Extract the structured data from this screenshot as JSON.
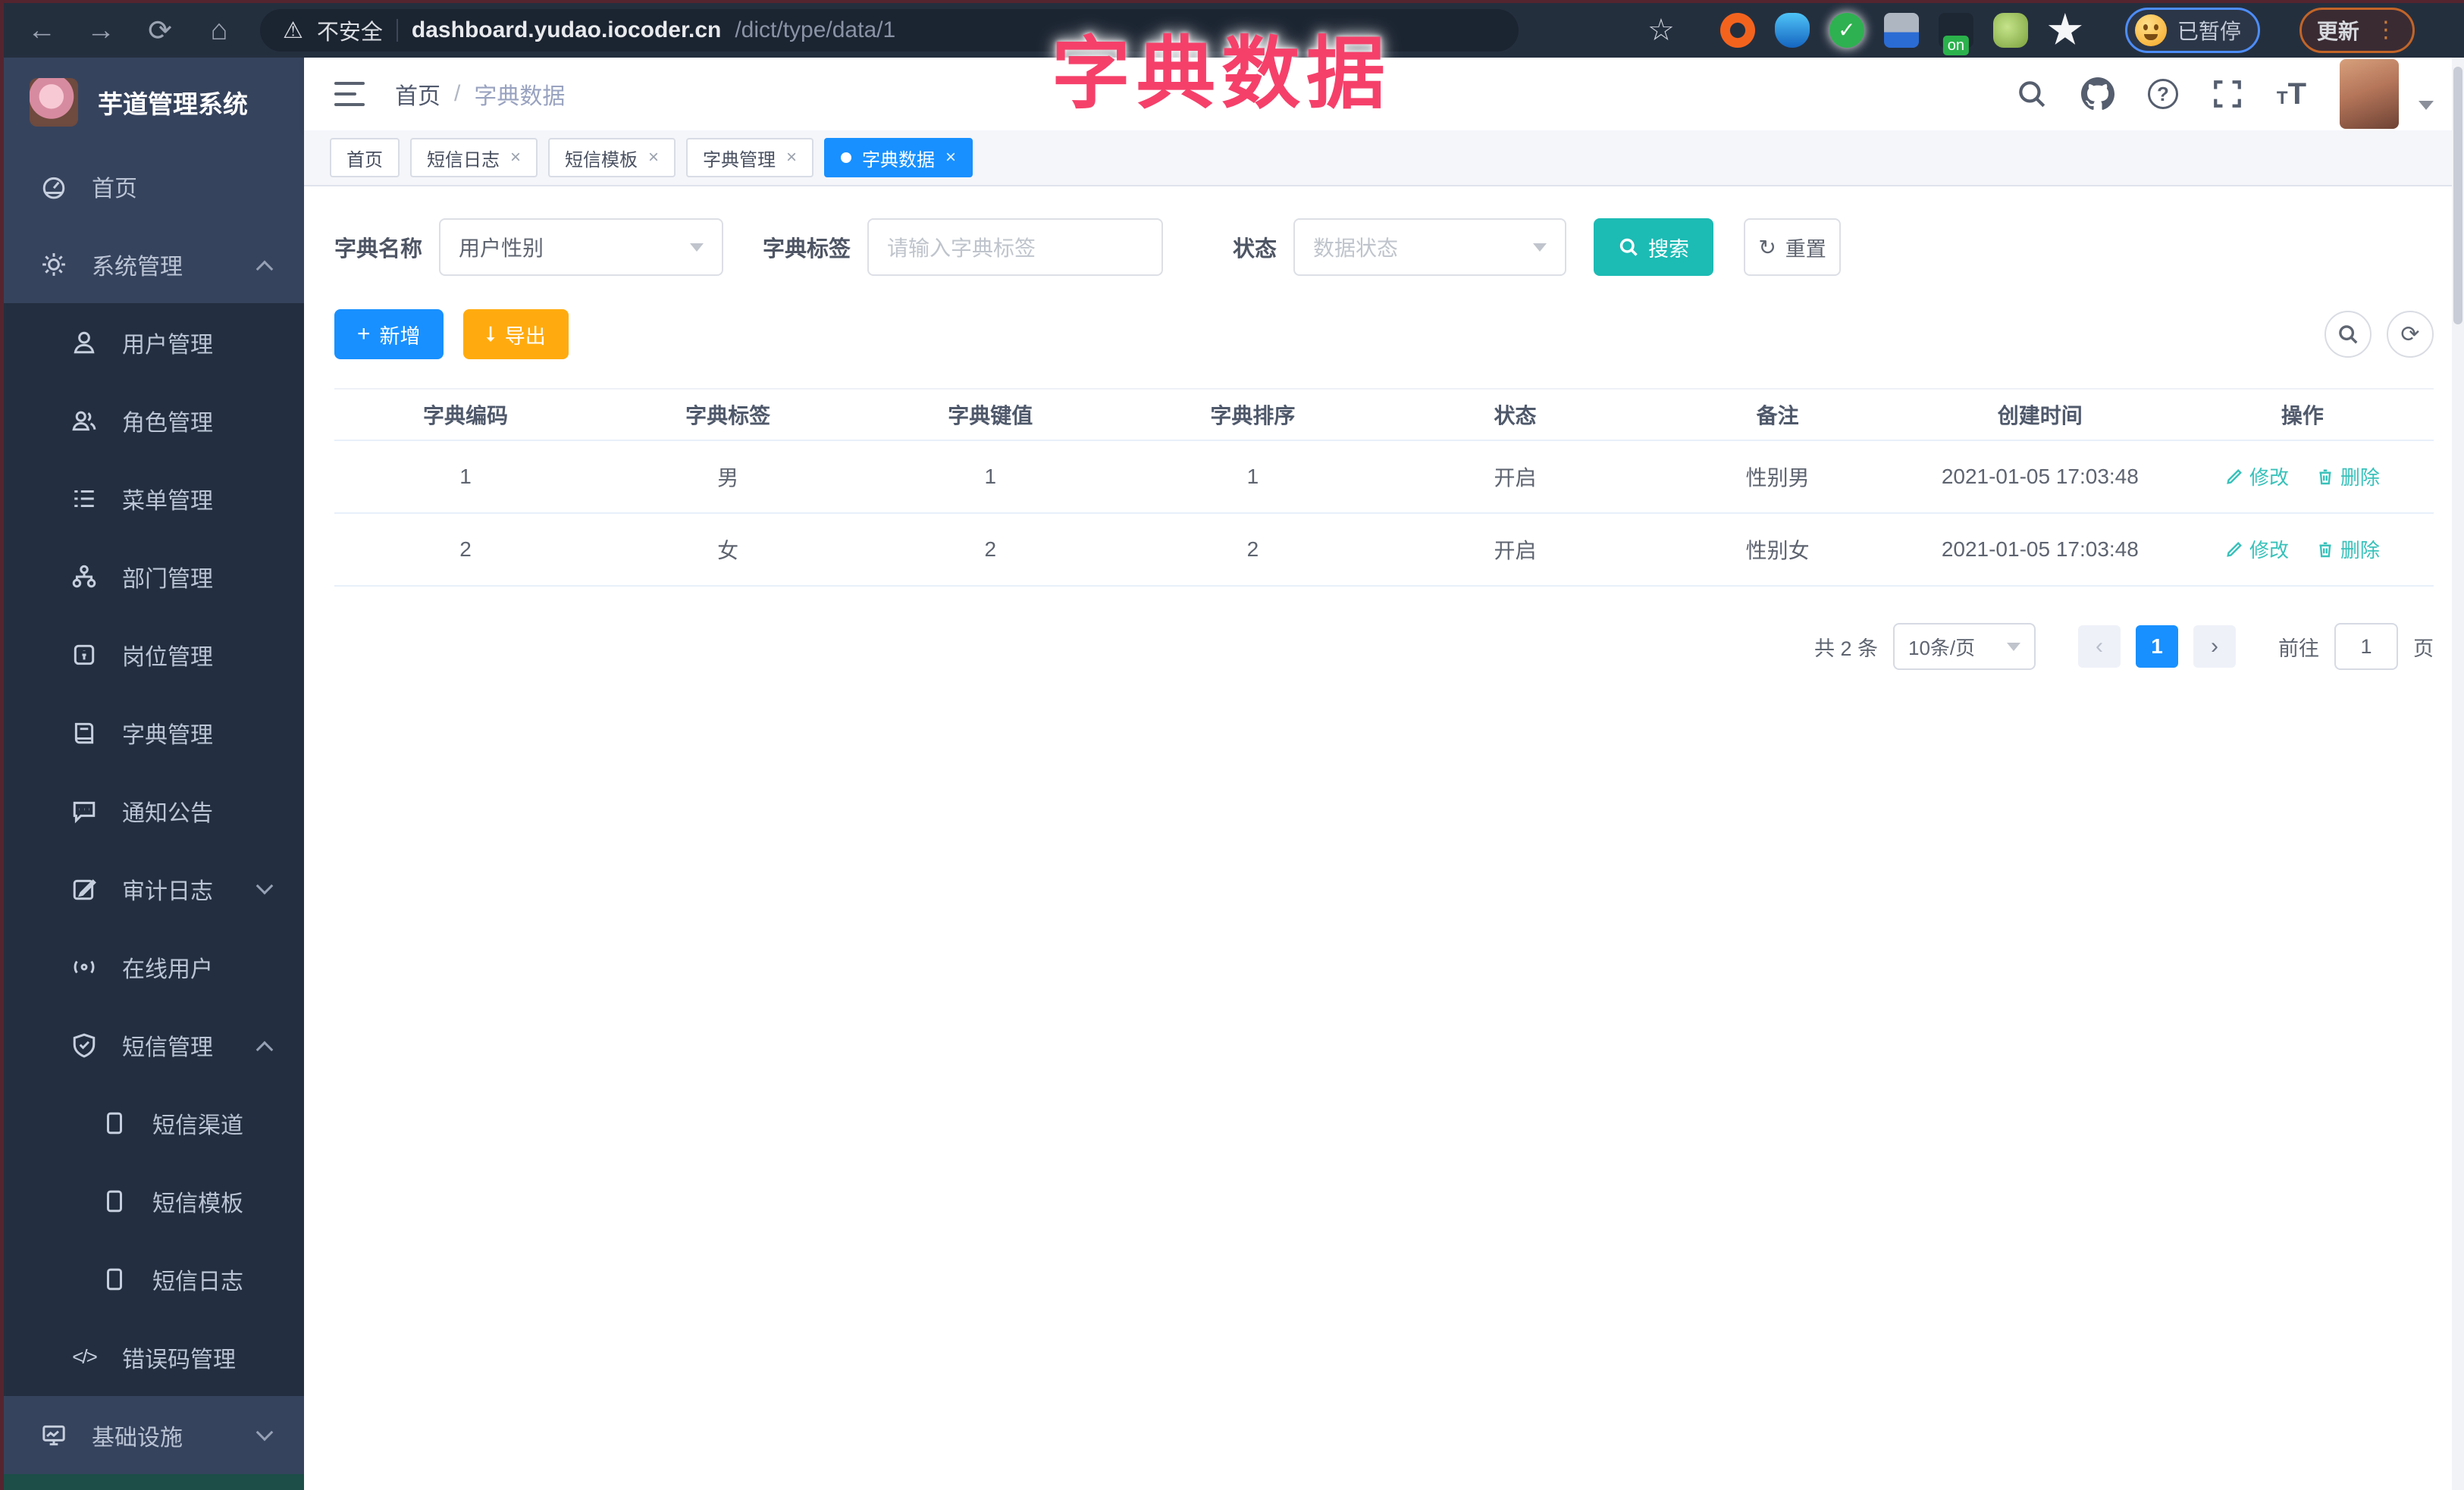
{
  "browser": {
    "security_label": "不安全",
    "url_domain": "dashboard.yudao.iocoder.cn",
    "url_path": "/dict/type/data/1",
    "paused_badge": "已暂停",
    "update_label": "更新",
    "extension_on_badge": "on"
  },
  "annotation": {
    "text": "字典数据",
    "color": "#f5406a"
  },
  "sidebar": {
    "title": "芋道管理系统",
    "items": [
      {
        "label": "首页"
      },
      {
        "label": "系统管理"
      },
      {
        "label": "用户管理"
      },
      {
        "label": "角色管理"
      },
      {
        "label": "菜单管理"
      },
      {
        "label": "部门管理"
      },
      {
        "label": "岗位管理"
      },
      {
        "label": "字典管理"
      },
      {
        "label": "通知公告"
      },
      {
        "label": "审计日志"
      },
      {
        "label": "在线用户"
      },
      {
        "label": "短信管理"
      },
      {
        "label": "短信渠道"
      },
      {
        "label": "短信模板"
      },
      {
        "label": "短信日志"
      },
      {
        "label": "错误码管理"
      },
      {
        "label": "基础设施"
      }
    ]
  },
  "navbar": {
    "breadcrumb_home": "首页",
    "breadcrumb_sep": "/",
    "breadcrumb_current": "字典数据"
  },
  "tabs": [
    {
      "label": "首页"
    },
    {
      "label": "短信日志"
    },
    {
      "label": "短信模板"
    },
    {
      "label": "字典管理"
    },
    {
      "label": "字典数据"
    }
  ],
  "filters": {
    "dict_name_label": "字典名称",
    "dict_name_value": "用户性别",
    "dict_label_label": "字典标签",
    "dict_label_placeholder": "请输入字典标签",
    "status_label": "状态",
    "status_placeholder": "数据状态",
    "search_label": "搜索",
    "reset_label": "重置"
  },
  "toolbar": {
    "add_label": "新增",
    "export_label": "导出"
  },
  "table": {
    "headers": [
      "字典编码",
      "字典标签",
      "字典键值",
      "字典排序",
      "状态",
      "备注",
      "创建时间",
      "操作"
    ],
    "rows": [
      {
        "code": "1",
        "label": "男",
        "value": "1",
        "sort": "1",
        "status": "开启",
        "remark": "性别男",
        "created": "2021-01-05 17:03:48",
        "edit": "修改",
        "delete": "删除"
      },
      {
        "code": "2",
        "label": "女",
        "value": "2",
        "sort": "2",
        "status": "开启",
        "remark": "性别女",
        "created": "2021-01-05 17:03:48",
        "edit": "修改",
        "delete": "删除"
      }
    ]
  },
  "pagination": {
    "total": "共 2 条",
    "page_size": "10条/页",
    "page": "1",
    "goto_label": "前往",
    "goto_value": "1",
    "page_unit": "页"
  }
}
